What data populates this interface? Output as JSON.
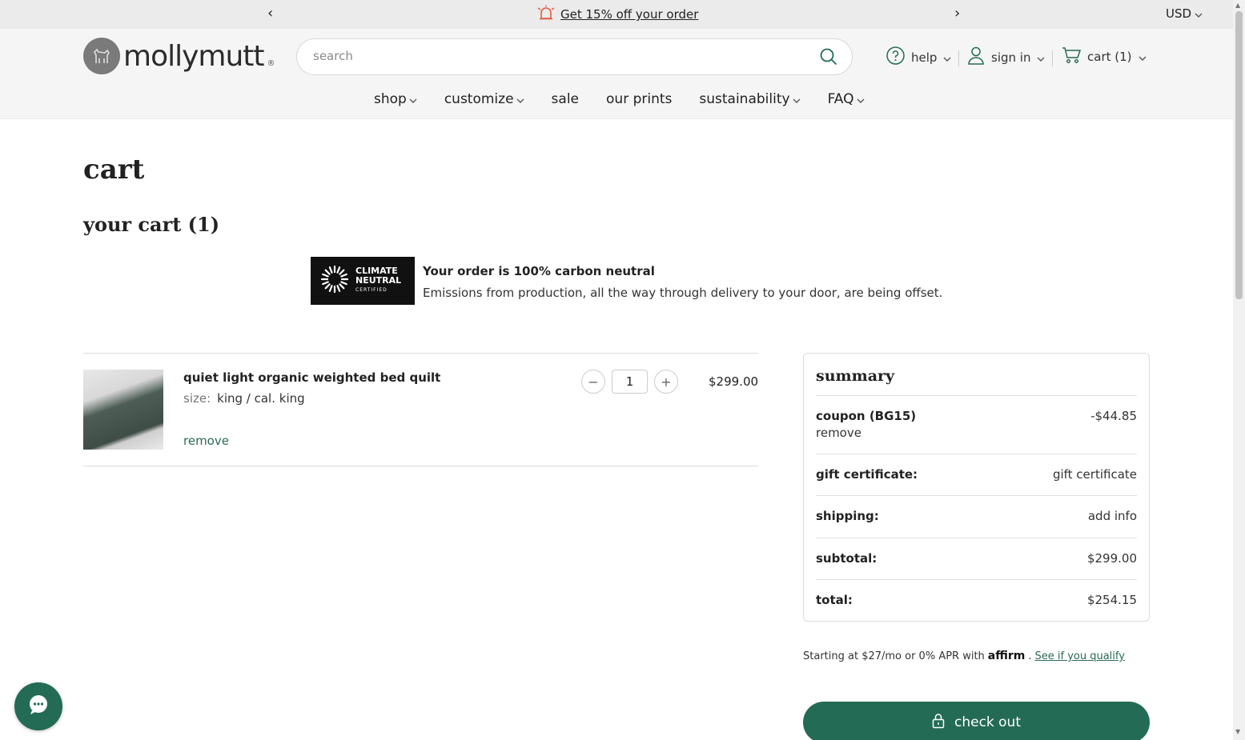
{
  "promo": {
    "prev_arrow": "‹",
    "next_arrow": "›",
    "link_text": "Get 15% off your order",
    "currency": "USD"
  },
  "header": {
    "logo_text": "mollymutt",
    "logo_reg": "®",
    "search_placeholder": "search",
    "help_label": "help",
    "signin_label": "sign in",
    "cart_label": "cart (1)"
  },
  "nav": {
    "items": [
      {
        "label": "shop",
        "dropdown": true
      },
      {
        "label": "customize",
        "dropdown": true
      },
      {
        "label": "sale",
        "dropdown": false
      },
      {
        "label": "our prints",
        "dropdown": false
      },
      {
        "label": "sustainability",
        "dropdown": true
      },
      {
        "label": "FAQ",
        "dropdown": true
      }
    ]
  },
  "page": {
    "title": "cart",
    "cart_heading": "your cart (1)"
  },
  "climate": {
    "badge_line1": "CLIMATE",
    "badge_line2": "NEUTRAL",
    "badge_line3": "CERTIFIED",
    "title": "Your order is 100% carbon neutral",
    "description": "Emissions from production, all the way through delivery to your door, are being offset."
  },
  "cart_item": {
    "name": "quiet light organic weighted bed quilt",
    "size_label": "size:",
    "size_value": "king / cal. king",
    "remove_label": "remove",
    "decrement": "−",
    "quantity": "1",
    "increment": "+",
    "price": "$299.00"
  },
  "summary": {
    "title": "summary",
    "coupon_label": "coupon (BG15)",
    "coupon_value": "-$44.85",
    "coupon_remove": "remove",
    "gift_label": "gift certificate:",
    "gift_value": "gift certificate",
    "shipping_label": "shipping:",
    "shipping_value": "add info",
    "subtotal_label": "subtotal:",
    "subtotal_value": "$299.00",
    "total_label": "total:",
    "total_value": "$254.15"
  },
  "affirm": {
    "prefix": "Starting at $27/mo or 0% APR with",
    "brand": "affirm",
    "link": "See if you qualify"
  },
  "checkout": {
    "label": "check out"
  },
  "colors": {
    "accent": "#236b55",
    "promo_icon": "#e25b3f",
    "promo_bg": "#ebebeb",
    "header_bg": "#f5f5f5"
  },
  "icons": [
    "chevron-left-icon",
    "chevron-right-icon",
    "alarm-icon",
    "search-icon",
    "help-icon",
    "user-icon",
    "cart-icon",
    "lock-icon",
    "chat-icon",
    "sun-burst-icon"
  ]
}
